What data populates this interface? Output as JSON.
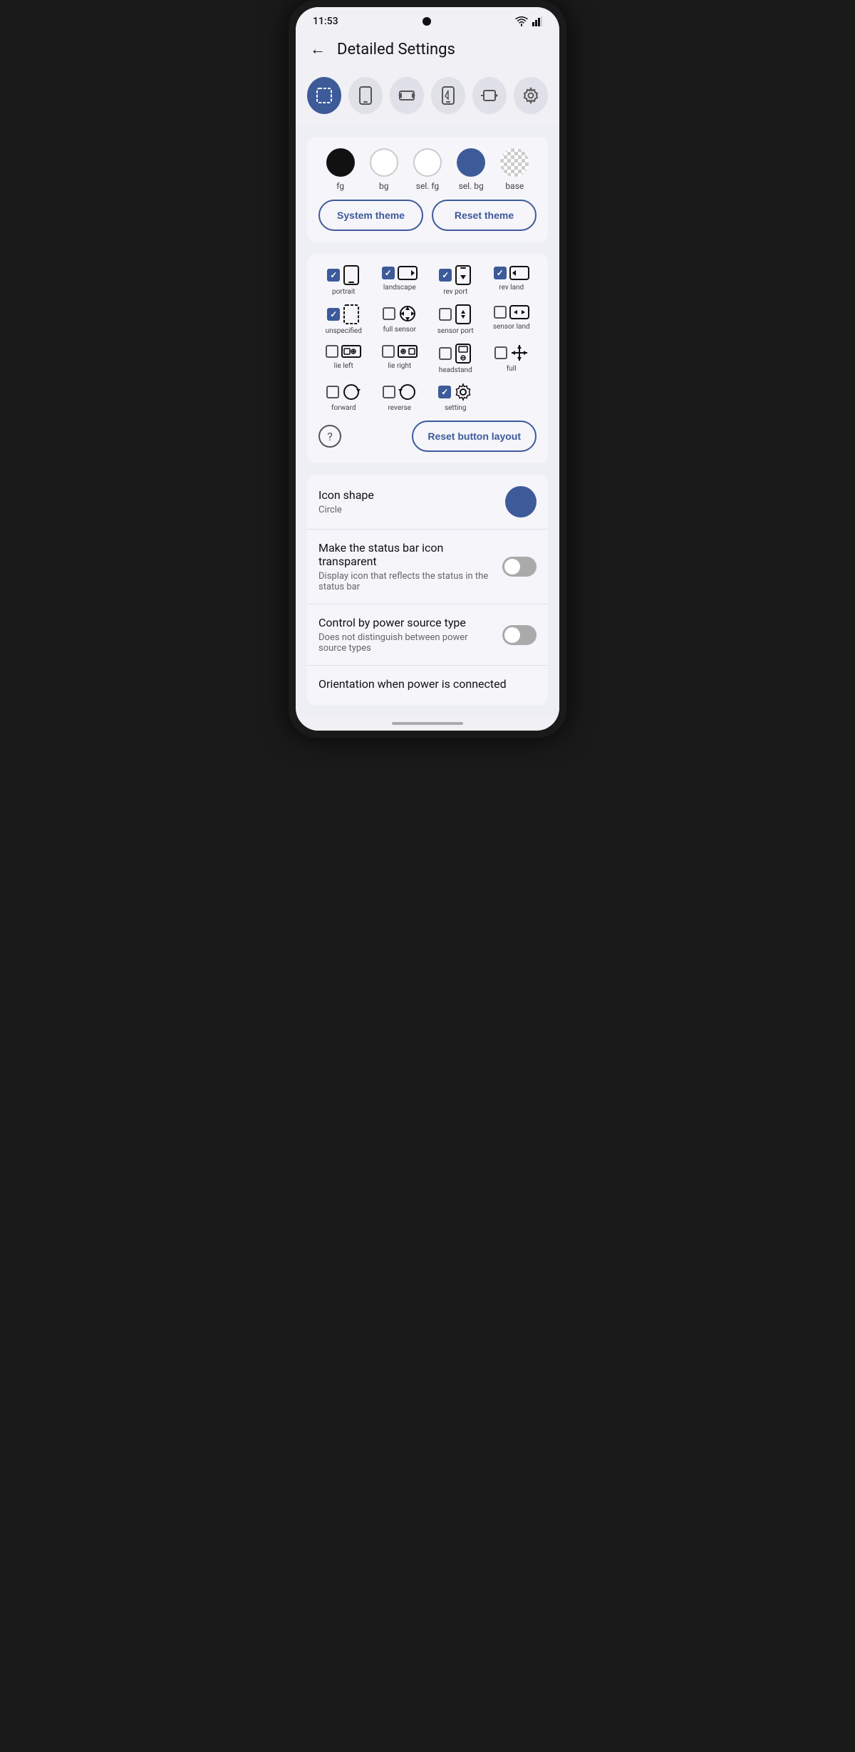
{
  "status": {
    "time": "11:53"
  },
  "header": {
    "title": "Detailed Settings",
    "back_label": "←"
  },
  "tabs": [
    {
      "id": "border",
      "active": true,
      "icon": "⬚"
    },
    {
      "id": "phone",
      "active": false,
      "icon": "📱"
    },
    {
      "id": "arrows",
      "active": false,
      "icon": "◀▶"
    },
    {
      "id": "phone2",
      "active": false,
      "icon": "📲"
    },
    {
      "id": "arrows2",
      "active": false,
      "icon": "▶|"
    },
    {
      "id": "settings",
      "active": false,
      "icon": "⚙"
    }
  ],
  "theme": {
    "colors": [
      {
        "id": "fg",
        "label": "fg",
        "color": "#111111",
        "type": "filled"
      },
      {
        "id": "bg",
        "label": "bg",
        "color": "#ffffff",
        "type": "outline"
      },
      {
        "id": "sel_fg",
        "label": "sel. fg",
        "color": "#ffffff",
        "type": "outline"
      },
      {
        "id": "sel_bg",
        "label": "sel. bg",
        "color": "#3d5a99",
        "type": "filled"
      },
      {
        "id": "base",
        "label": "base",
        "color": "checker",
        "type": "checker"
      }
    ],
    "system_theme_label": "System theme",
    "reset_theme_label": "Reset theme"
  },
  "orientations": {
    "rows": [
      [
        {
          "id": "portrait",
          "label": "portrait",
          "checked": true
        },
        {
          "id": "landscape",
          "label": "landscape",
          "checked": true
        },
        {
          "id": "rev_port",
          "label": "rev port",
          "checked": true
        },
        {
          "id": "rev_land",
          "label": "rev land",
          "checked": true
        }
      ],
      [
        {
          "id": "unspecified",
          "label": "unspecified",
          "checked": true
        },
        {
          "id": "full_sensor",
          "label": "full sensor",
          "checked": false
        },
        {
          "id": "sensor_port",
          "label": "sensor port",
          "checked": false
        },
        {
          "id": "sensor_land",
          "label": "sensor land",
          "checked": false
        }
      ],
      [
        {
          "id": "lie_left",
          "label": "lie left",
          "checked": false
        },
        {
          "id": "lie_right",
          "label": "lie right",
          "checked": false
        },
        {
          "id": "headstand",
          "label": "headstand",
          "checked": false
        },
        {
          "id": "full",
          "label": "full",
          "checked": false
        }
      ],
      [
        {
          "id": "forward",
          "label": "forward",
          "checked": false
        },
        {
          "id": "reverse",
          "label": "reverse",
          "checked": false
        },
        {
          "id": "setting",
          "label": "setting",
          "checked": true
        },
        null
      ]
    ],
    "reset_button_layout_label": "Reset button layout"
  },
  "settings": [
    {
      "id": "icon_shape",
      "title": "Icon shape",
      "desc": "Circle",
      "control": "blue_circle"
    },
    {
      "id": "status_bar_transparent",
      "title": "Make the status bar icon transparent",
      "desc": "Display icon that reflects the status in the status bar",
      "control": "toggle",
      "toggle_on": false
    },
    {
      "id": "power_source",
      "title": "Control by power source type",
      "desc": "Does not distinguish between power source types",
      "control": "toggle",
      "toggle_on": false
    },
    {
      "id": "orientation_power",
      "title": "Orientation when power is connected",
      "desc": "",
      "control": "none"
    }
  ]
}
